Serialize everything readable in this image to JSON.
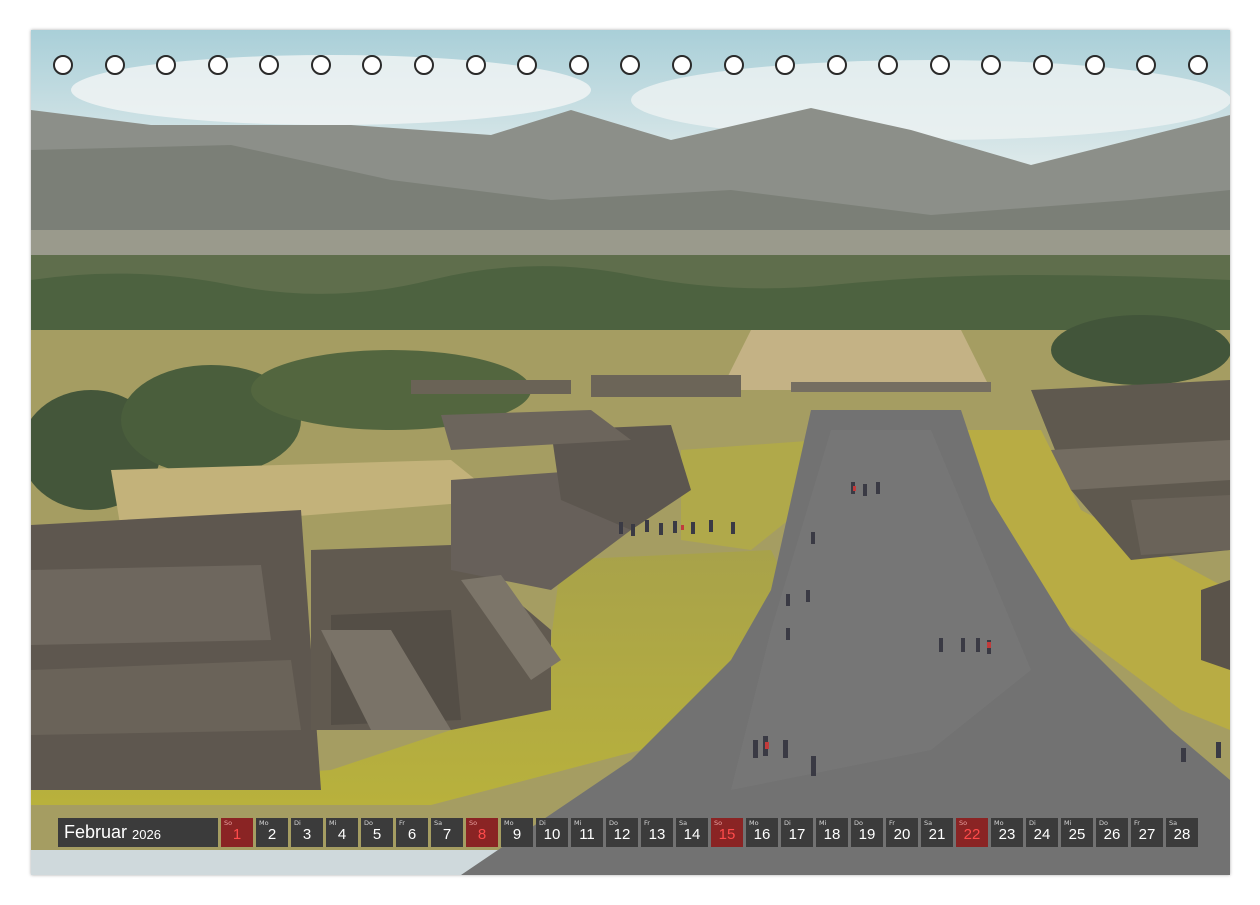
{
  "calendar": {
    "month": "Februar",
    "year": "2026",
    "days": [
      {
        "wd": "So",
        "num": "1",
        "sunday": true
      },
      {
        "wd": "Mo",
        "num": "2"
      },
      {
        "wd": "Di",
        "num": "3"
      },
      {
        "wd": "Mi",
        "num": "4"
      },
      {
        "wd": "Do",
        "num": "5"
      },
      {
        "wd": "Fr",
        "num": "6"
      },
      {
        "wd": "Sa",
        "num": "7"
      },
      {
        "wd": "So",
        "num": "8",
        "sunday": true
      },
      {
        "wd": "Mo",
        "num": "9"
      },
      {
        "wd": "Di",
        "num": "10"
      },
      {
        "wd": "Mi",
        "num": "11"
      },
      {
        "wd": "Do",
        "num": "12"
      },
      {
        "wd": "Fr",
        "num": "13"
      },
      {
        "wd": "Sa",
        "num": "14"
      },
      {
        "wd": "So",
        "num": "15",
        "sunday": true
      },
      {
        "wd": "Mo",
        "num": "16"
      },
      {
        "wd": "Di",
        "num": "17"
      },
      {
        "wd": "Mi",
        "num": "18"
      },
      {
        "wd": "Do",
        "num": "19"
      },
      {
        "wd": "Fr",
        "num": "20"
      },
      {
        "wd": "Sa",
        "num": "21"
      },
      {
        "wd": "So",
        "num": "22",
        "sunday": true
      },
      {
        "wd": "Mo",
        "num": "23"
      },
      {
        "wd": "Di",
        "num": "24"
      },
      {
        "wd": "Mi",
        "num": "25"
      },
      {
        "wd": "Do",
        "num": "26"
      },
      {
        "wd": "Fr",
        "num": "27"
      },
      {
        "wd": "Sa",
        "num": "28"
      }
    ]
  },
  "colors": {
    "bar": "#3b3b3b",
    "sunday_bg": "#8a2424",
    "sunday_text": "#ff4b4b",
    "grass": "#b9b447",
    "avenue": "#737373",
    "stone": "#6d665c",
    "sky": "#c9dde2"
  }
}
